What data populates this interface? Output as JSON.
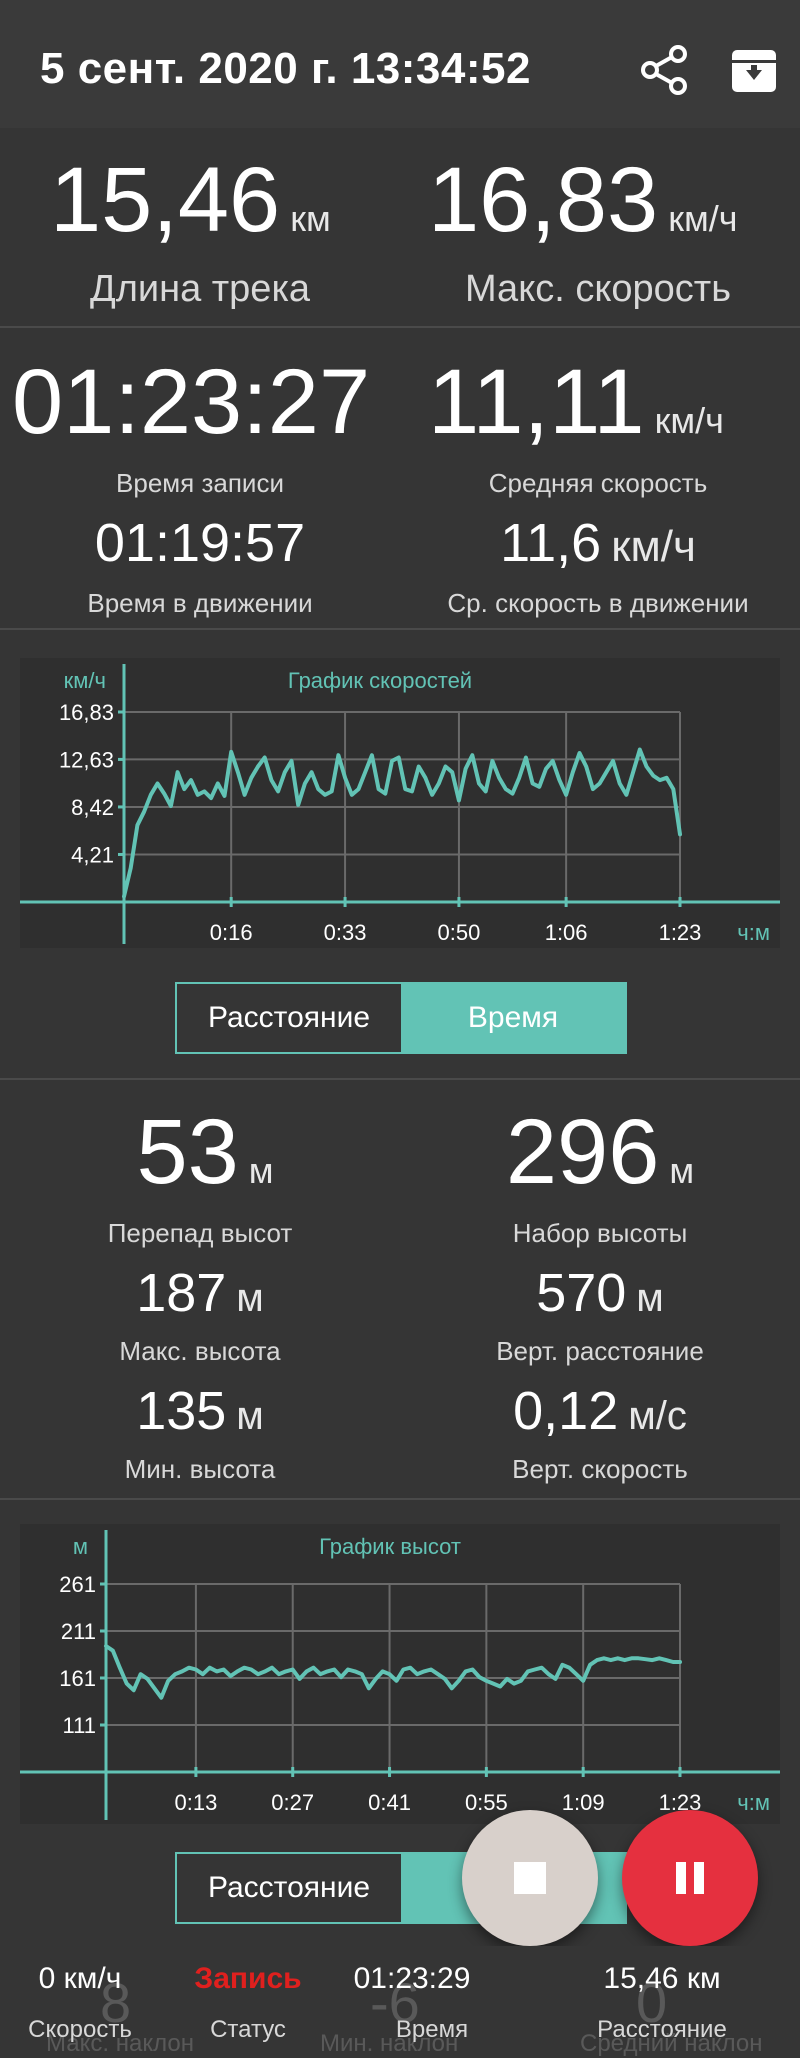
{
  "header": {
    "title": "5 сент. 2020 г. 13:34:52",
    "share_icon": "share-icon",
    "archive_icon": "archive-download-icon"
  },
  "stats": {
    "track_length": {
      "value": "15,46",
      "unit": "км",
      "label": "Длина трека"
    },
    "max_speed": {
      "value": "16,83",
      "unit": "км/ч",
      "label": "Макс. скорость"
    },
    "record_time": {
      "value": "01:23:27",
      "label": "Время записи"
    },
    "avg_speed": {
      "value": "11,11",
      "unit": "км/ч",
      "label": "Средняя скорость"
    },
    "moving_time": {
      "value": "01:19:57",
      "label": "Время в движении"
    },
    "moving_avg_speed": {
      "value": "11,6",
      "unit": "км/ч",
      "label": "Ср. скорость в движении"
    }
  },
  "speed_chart_toggle": {
    "distance": "Расстояние",
    "time": "Время"
  },
  "elevation": {
    "diff": {
      "value": "53",
      "unit": "м",
      "label": "Перепад высот"
    },
    "gain": {
      "value": "296",
      "unit": "м",
      "label": "Набор высоты"
    },
    "max": {
      "value": "187",
      "unit": "м",
      "label": "Макс. высота"
    },
    "vertical_distance": {
      "value": "570",
      "unit": "м",
      "label": "Верт. расстояние"
    },
    "min": {
      "value": "135",
      "unit": "м",
      "label": "Мин. высота"
    },
    "vertical_speed": {
      "value": "0,12",
      "unit": "м/с",
      "label": "Верт. скорость"
    }
  },
  "elevation_chart_toggle": {
    "distance": "Расстояние"
  },
  "fabs": {
    "stop_icon": "stop-icon",
    "pause_icon": "pause-icon",
    "stop_color": "#d8d0cb",
    "pause_color": "#e5303f"
  },
  "bottom_bar": {
    "speed": {
      "value": "0 км/ч",
      "label": "Скорость"
    },
    "status": {
      "value": "Запись",
      "label": "Статус",
      "color": "#e0201e"
    },
    "time": {
      "value": "01:23:29",
      "label": "Время"
    },
    "distance": {
      "value": "15,46 км",
      "label": "Расстояние"
    },
    "ghost": [
      {
        "value": "8",
        "label": "Макс. наклон"
      },
      {
        "value": "-6",
        "label": "Мин. наклон"
      },
      {
        "value": "0",
        "label": "Средний наклон"
      }
    ]
  },
  "accent_color": "#62c3b5",
  "chart_data": [
    {
      "type": "line",
      "title": "График скоростей",
      "ylabel": "км/ч",
      "xlabel": "ч:м",
      "x_ticks": [
        "0:16",
        "0:33",
        "0:50",
        "1:06",
        "1:23"
      ],
      "y_ticks": [
        "4,21",
        "8,42",
        "12,63",
        "16,83"
      ],
      "xlim_minutes": [
        0,
        83
      ],
      "ylim": [
        0,
        16.83
      ],
      "grid": true,
      "series": [
        {
          "x": [
            0,
            1,
            2,
            3,
            4,
            5,
            6,
            7,
            8,
            9,
            10,
            11,
            12,
            13,
            14,
            15,
            16,
            17,
            18,
            19,
            20,
            21,
            22,
            23,
            24,
            25,
            26,
            27,
            28,
            29,
            30,
            31,
            32,
            33,
            34,
            35,
            36,
            37,
            38,
            39,
            40,
            41,
            42,
            43,
            44,
            45,
            46,
            47,
            48,
            49,
            50,
            51,
            52,
            53,
            54,
            55,
            56,
            57,
            58,
            59,
            60,
            61,
            62,
            63,
            64,
            65,
            66,
            67,
            68,
            69,
            70,
            71,
            72,
            73,
            74,
            75,
            76,
            77,
            78,
            79,
            80,
            81,
            82,
            83
          ],
          "values": [
            0.5,
            3.0,
            6.8,
            8.0,
            9.5,
            10.5,
            9.6,
            8.5,
            11.5,
            10.0,
            10.8,
            9.5,
            9.8,
            9.2,
            10.5,
            9.4,
            13.3,
            11.5,
            9.5,
            11.0,
            12.0,
            12.8,
            10.8,
            9.8,
            11.5,
            12.5,
            8.6,
            10.5,
            11.5,
            10.0,
            9.5,
            9.8,
            13.0,
            11.0,
            9.5,
            10.0,
            11.5,
            13.0,
            10.0,
            9.6,
            12.5,
            12.8,
            10.0,
            9.8,
            12.0,
            11.0,
            9.5,
            10.5,
            12.0,
            11.5,
            9.0,
            11.8,
            13.0,
            10.5,
            9.8,
            12.5,
            11.0,
            10.0,
            9.6,
            11.0,
            12.8,
            10.5,
            10.2,
            11.8,
            12.5,
            10.8,
            9.5,
            11.5,
            13.2,
            12.0,
            10.0,
            10.5,
            11.5,
            12.5,
            10.5,
            9.5,
            11.5,
            13.5,
            12.0,
            11.2,
            10.8,
            11.0,
            10.0,
            6.0
          ]
        }
      ]
    },
    {
      "type": "line",
      "title": "График высот",
      "ylabel": "м",
      "xlabel": "ч:м",
      "x_ticks": [
        "0:13",
        "0:27",
        "0:41",
        "0:55",
        "1:09",
        "1:23"
      ],
      "y_ticks": [
        "111",
        "161",
        "211",
        "261"
      ],
      "xlim_minutes": [
        0,
        83
      ],
      "ylim": [
        61,
        261
      ],
      "grid": true,
      "series": [
        {
          "x": [
            0,
            1,
            2,
            3,
            4,
            5,
            6,
            7,
            8,
            9,
            10,
            11,
            12,
            13,
            14,
            15,
            16,
            17,
            18,
            19,
            20,
            21,
            22,
            23,
            24,
            25,
            26,
            27,
            28,
            29,
            30,
            31,
            32,
            33,
            34,
            35,
            36,
            37,
            38,
            39,
            40,
            41,
            42,
            43,
            44,
            45,
            46,
            47,
            48,
            49,
            50,
            51,
            52,
            53,
            54,
            55,
            56,
            57,
            58,
            59,
            60,
            61,
            62,
            63,
            64,
            65,
            66,
            67,
            68,
            69,
            70,
            71,
            72,
            73,
            74,
            75,
            76,
            77,
            78,
            79,
            80,
            81,
            82,
            83
          ],
          "values": [
            195,
            190,
            172,
            155,
            148,
            165,
            160,
            150,
            140,
            158,
            165,
            168,
            172,
            170,
            165,
            172,
            168,
            170,
            163,
            168,
            172,
            170,
            165,
            168,
            172,
            165,
            168,
            170,
            160,
            168,
            172,
            165,
            168,
            170,
            162,
            170,
            168,
            165,
            150,
            160,
            168,
            165,
            158,
            170,
            172,
            165,
            168,
            170,
            165,
            160,
            150,
            158,
            168,
            170,
            162,
            158,
            155,
            152,
            160,
            155,
            158,
            168,
            170,
            172,
            165,
            160,
            175,
            172,
            165,
            158,
            175,
            180,
            182,
            180,
            182,
            180,
            182,
            182,
            181,
            180,
            182,
            180,
            178,
            178
          ]
        }
      ]
    }
  ]
}
